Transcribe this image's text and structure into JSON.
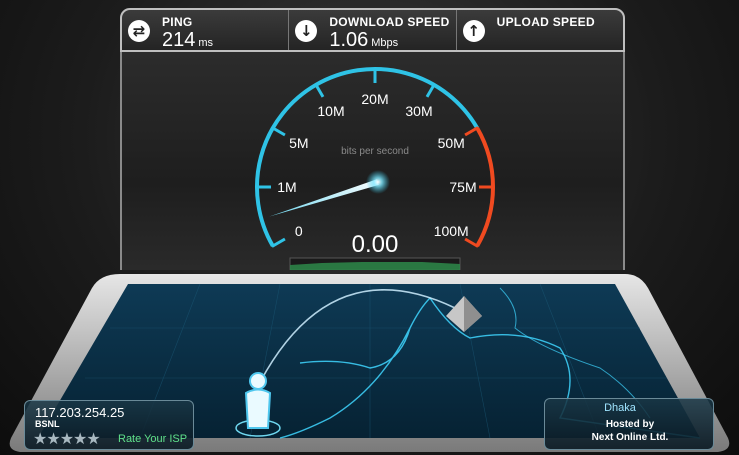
{
  "stats": {
    "ping": {
      "label": "PING",
      "value": "214",
      "unit": "ms",
      "icon": "ping-arrows-icon"
    },
    "download": {
      "label": "DOWNLOAD SPEED",
      "value": "1.06",
      "unit": "Mbps",
      "icon": "download-arrow-icon"
    },
    "upload": {
      "label": "UPLOAD SPEED",
      "value": "",
      "unit": "",
      "icon": "upload-arrow-icon"
    }
  },
  "gauge": {
    "caption": "bits per second",
    "reading": "0.00",
    "ticks": [
      "0",
      "1M",
      "5M",
      "10M",
      "20M",
      "30M",
      "50M",
      "75M",
      "100M"
    ],
    "needle_fraction": 0.06,
    "accent_color": "#2fc3e6",
    "danger_color": "#f04a20"
  },
  "client": {
    "ip": "117.203.254.25",
    "isp": "BSNL",
    "stars": "★★★★★",
    "rate_label": "Rate Your ISP"
  },
  "server": {
    "city": "Dhaka",
    "hosted_label": "Hosted by",
    "host": "Next Online Ltd."
  }
}
